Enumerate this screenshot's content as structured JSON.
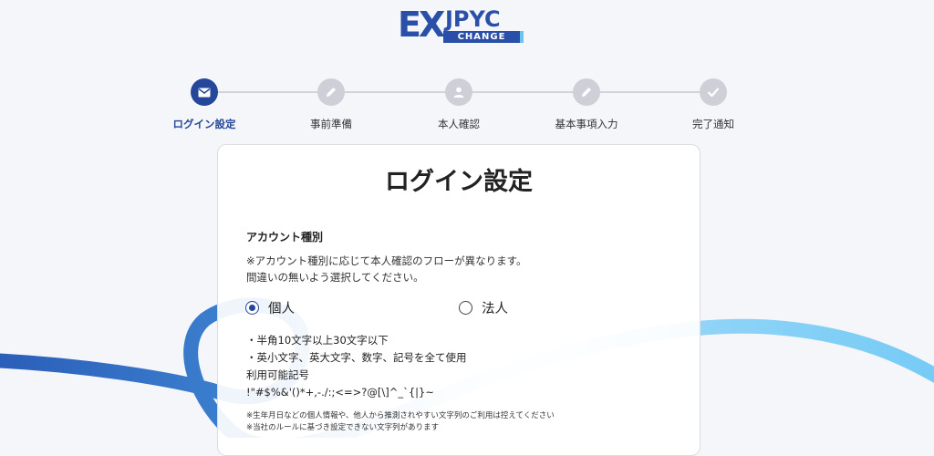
{
  "logo": {
    "ex": "EX",
    "jpyc": "JPYC",
    "change": "CHANGE"
  },
  "steps": [
    {
      "label": "ログイン設定",
      "icon": "envelope-icon",
      "active": true
    },
    {
      "label": "事前準備",
      "icon": "pencil-icon",
      "active": false
    },
    {
      "label": "本人確認",
      "icon": "person-icon",
      "active": false
    },
    {
      "label": "基本事項入力",
      "icon": "pencil-icon",
      "active": false
    },
    {
      "label": "完了通知",
      "icon": "check-icon",
      "active": false
    }
  ],
  "form": {
    "title": "ログイン設定",
    "account_type_label": "アカウント種別",
    "account_note_line1": "※アカウント種別に応じて本人確認のフローが異なります。",
    "account_note_line2": "間違いの無いよう選択してください。",
    "options": [
      {
        "label": "個人",
        "selected": true
      },
      {
        "label": "法人",
        "selected": false
      }
    ],
    "rules": [
      "・半角10文字以上30文字以下",
      "・英小文字、英大文字、数字、記号を全て使用",
      "利用可能記号",
      "!\"#$%&'()*+,-./:;<=>?@[\\]^_`{|}~"
    ],
    "notes": [
      "※生年月日などの個人情報や、他人から推測されやすい文字列のご利用は控えてください",
      "※当社のルールに基づき設定できない文字列があります"
    ]
  },
  "colors": {
    "brand": "#24469b",
    "inactive_step": "#cdd0d6",
    "wave_dark": "#2a5db8",
    "wave_light": "#74cbf6"
  }
}
